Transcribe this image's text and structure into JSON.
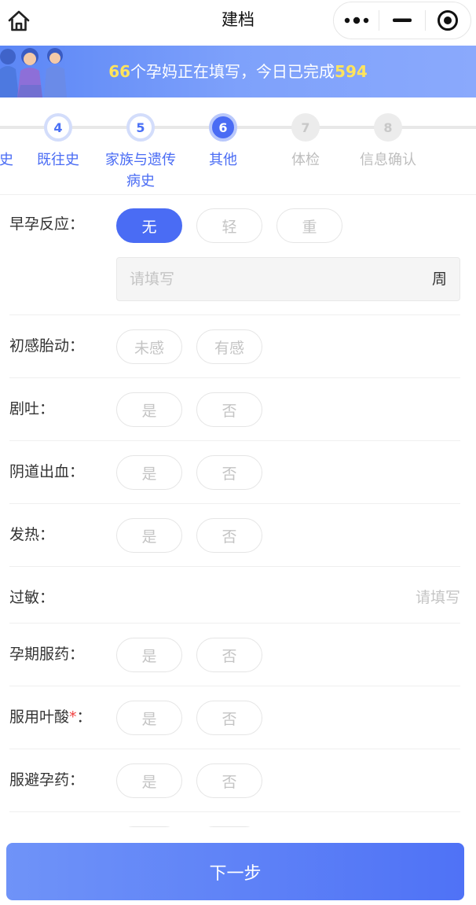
{
  "nav": {
    "title": "建档",
    "icons": {
      "home": "home-icon",
      "more": "more-dots-icon",
      "minimize": "minimize-icon",
      "close": "target-circle-icon"
    }
  },
  "banner": {
    "count_filling": "66",
    "text_mid": "个孕妈正在填写，今日已完成",
    "count_done": "594"
  },
  "steps": [
    {
      "num": "",
      "label": "史",
      "label2": "",
      "state": "done"
    },
    {
      "num": "4",
      "label": "既往史",
      "label2": "",
      "state": "done"
    },
    {
      "num": "5",
      "label": "家族与遗传",
      "label2": "病史",
      "state": "done"
    },
    {
      "num": "6",
      "label": "其他",
      "label2": "",
      "state": "active"
    },
    {
      "num": "7",
      "label": "体检",
      "label2": "",
      "state": "todo"
    },
    {
      "num": "8",
      "label": "信息确认",
      "label2": "",
      "state": "todo"
    }
  ],
  "form": {
    "early_reaction": {
      "label": "早孕反应：",
      "options": [
        "无",
        "轻",
        "重"
      ],
      "selected": "无",
      "week_placeholder": "请填写",
      "week_unit": "周"
    },
    "fetal_movement": {
      "label": "初感胎动：",
      "options": [
        "未感",
        "有感"
      ]
    },
    "vomiting": {
      "label": "剧吐：",
      "options": [
        "是",
        "否"
      ]
    },
    "bleeding": {
      "label": "阴道出血：",
      "options": [
        "是",
        "否"
      ]
    },
    "fever": {
      "label": "发热：",
      "options": [
        "是",
        "否"
      ]
    },
    "allergy": {
      "label": "过敏：",
      "placeholder": "请填写"
    },
    "medication": {
      "label": "孕期服药：",
      "options": [
        "是",
        "否"
      ]
    },
    "folic_acid": {
      "label": "服用叶酸",
      "required_mark": "*",
      "colon": "：",
      "options": [
        "是",
        "否"
      ]
    },
    "contraceptive": {
      "label": "服避孕药：",
      "options": [
        "是",
        "否"
      ]
    }
  },
  "footer": {
    "next_label": "下一步"
  }
}
